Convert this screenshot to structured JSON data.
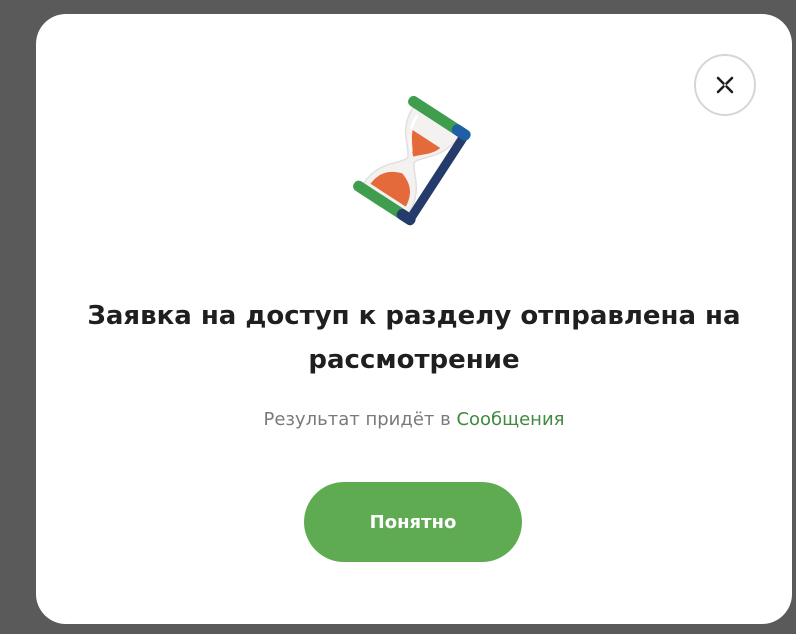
{
  "dialog": {
    "title": "Заявка на доступ к разделу отправлена на рассмотрение",
    "subtitle_prefix": "Результат придёт в",
    "subtitle_link": "Сообщения",
    "ok_button_label": "Понятно",
    "close_icon": "close-icon",
    "illustration_icon": "hourglass-icon"
  },
  "colors": {
    "accent_green": "#5fab52",
    "link_green": "#3f8a3f",
    "overlay": "#5a5a5a",
    "title_text": "#1f1f1f",
    "subtitle_text": "#7a7a7a"
  }
}
